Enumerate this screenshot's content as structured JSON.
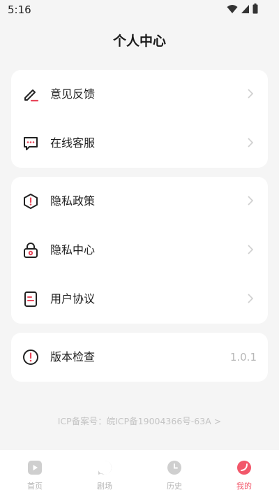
{
  "status": {
    "time": "5:16"
  },
  "page": {
    "title": "个人中心"
  },
  "group1": [
    {
      "label": "意见反馈",
      "icon": "edit-pencil-icon"
    },
    {
      "label": "在线客服",
      "icon": "chat-bubble-icon"
    }
  ],
  "group2": [
    {
      "label": "隐私政策",
      "icon": "shield-alert-icon"
    },
    {
      "label": "隐私中心",
      "icon": "lock-icon"
    },
    {
      "label": "用户协议",
      "icon": "document-icon"
    }
  ],
  "group3": [
    {
      "label": "版本检查",
      "icon": "info-circle-icon",
      "value": "1.0.1"
    }
  ],
  "footer": {
    "icp": "ICP备案号：皖ICP备19004366号-63A >"
  },
  "tabs": [
    {
      "label": "首页",
      "icon": "home-play-icon"
    },
    {
      "label": "剧场",
      "icon": "theater-play-icon"
    },
    {
      "label": "历史",
      "icon": "clock-icon"
    },
    {
      "label": "我的",
      "icon": "profile-icon",
      "active": true
    }
  ],
  "colors": {
    "accent": "#f2576a",
    "icon_alert": "#e8465a",
    "text": "#1f1f1f",
    "muted": "#b8b8b8"
  }
}
